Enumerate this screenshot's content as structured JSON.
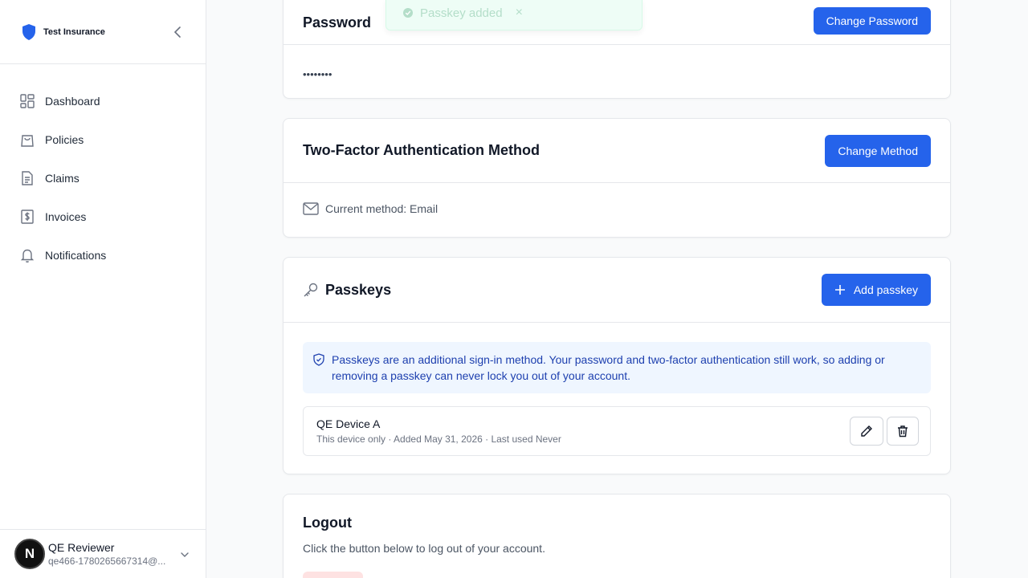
{
  "brand": {
    "name": "Test Insurance",
    "accent": "#2563eb"
  },
  "sidebar": {
    "items": [
      {
        "label": "Dashboard",
        "icon": "dashboard-icon"
      },
      {
        "label": "Policies",
        "icon": "shopping-bag-icon"
      },
      {
        "label": "Claims",
        "icon": "document-icon"
      },
      {
        "label": "Invoices",
        "icon": "dollar-receipt-icon"
      },
      {
        "label": "Notifications",
        "icon": "bell-icon"
      }
    ],
    "user": {
      "initial": "N",
      "name": "QE Reviewer",
      "email": "qe466-1780265667314@..."
    }
  },
  "toast": {
    "text": "Passkey added",
    "close": "×"
  },
  "password": {
    "title": "Password",
    "button": "Change Password",
    "value": "••••••••"
  },
  "two_factor": {
    "title": "Two-Factor Authentication Method",
    "button": "Change Method",
    "current": "Current method: Email"
  },
  "passkeys": {
    "title": "Passkeys",
    "button": "Add passkey",
    "info": "Passkeys are an additional sign-in method. Your password and two-factor authentication still work, so adding or removing a passkey can never lock you out of your account.",
    "items": [
      {
        "name": "QE Device A",
        "meta": "This device only · Added May 31, 2026 · Last used Never"
      }
    ]
  },
  "logout": {
    "title": "Logout",
    "description": "Click the button below to log out of your account."
  }
}
